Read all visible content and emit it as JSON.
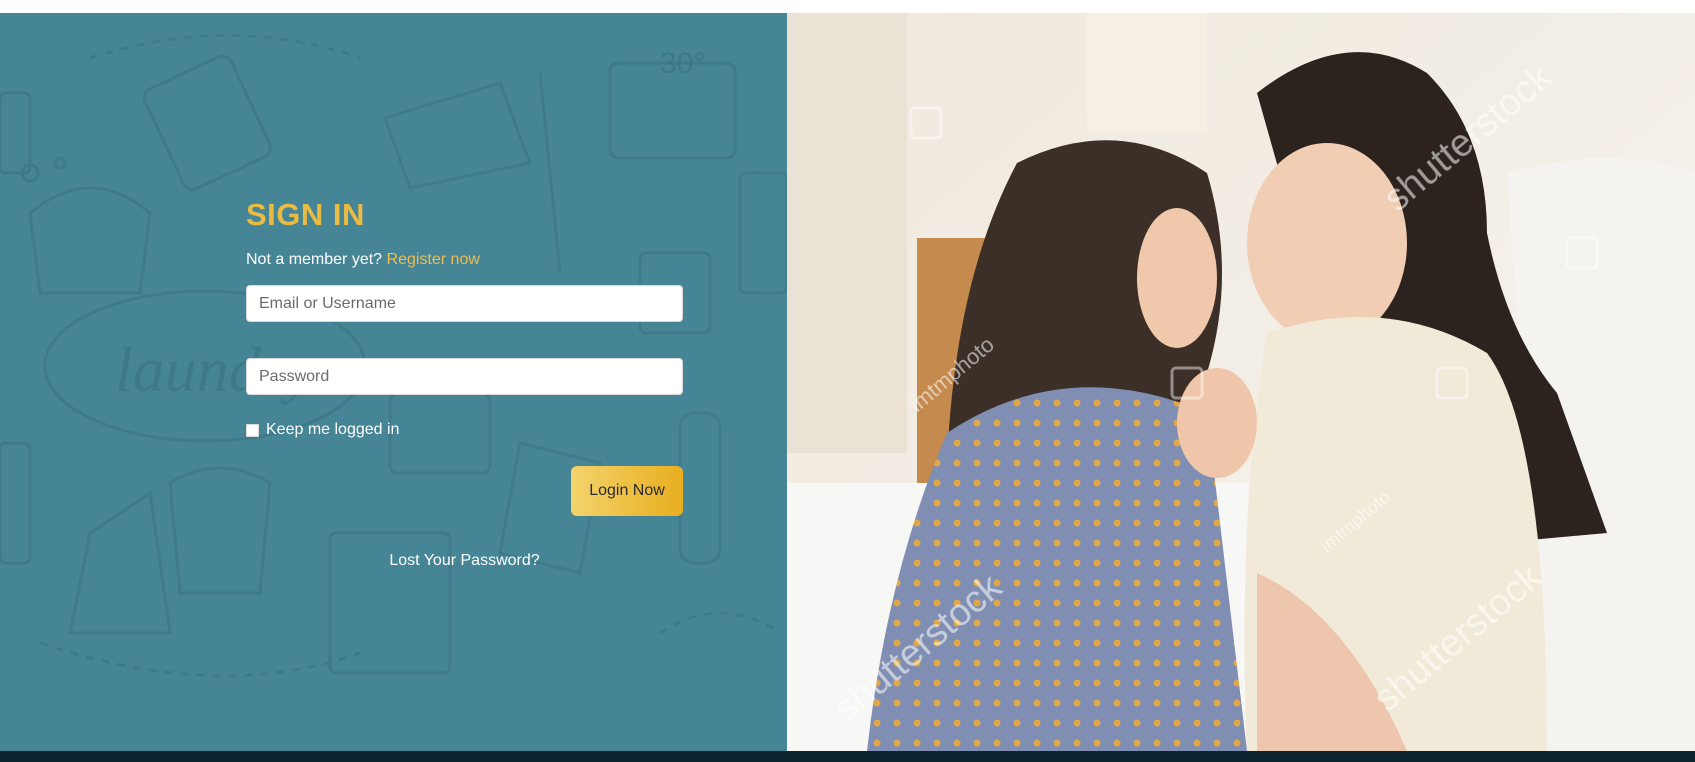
{
  "login": {
    "title": "SIGN IN",
    "member_prompt": "Not a member yet?",
    "register_link": "Register now",
    "email_placeholder": "Email or Username",
    "password_placeholder": "Password",
    "remember_label": "Keep me logged in",
    "login_button": "Login Now",
    "lost_password": "Lost Your Password?"
  },
  "background": {
    "pattern_word": "laundry",
    "pattern_temp": "30°"
  },
  "photo": {
    "watermarks": [
      "shutterstock",
      "imtmphoto",
      "shutterstock",
      "shutterstock",
      "imtmphoto"
    ]
  },
  "colors": {
    "panel": "#458596",
    "accent": "#e9bb43",
    "button_start": "#f3d36b",
    "button_end": "#e8ae1f",
    "footer": "#0c2530"
  }
}
